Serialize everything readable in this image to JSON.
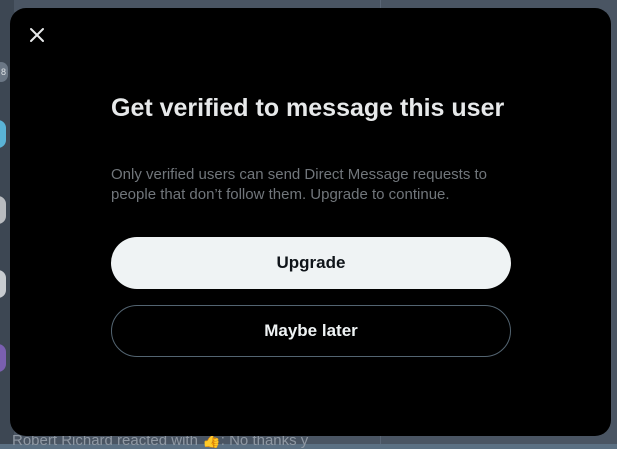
{
  "background": {
    "badge_text": "8",
    "footer_text": "Robert Richard reacted with 👍: No thanks y"
  },
  "modal": {
    "close_icon": "close-icon",
    "title": "Get verified to message this user",
    "description": "Only verified users can send Direct Message requests to people that don’t follow them. Upgrade to continue.",
    "primary_button": "Upgrade",
    "secondary_button": "Maybe later"
  },
  "colors": {
    "modal_bg": "#000000",
    "title_text": "#e7e9ea",
    "secondary_text": "#71767b",
    "primary_button_bg": "#eff3f4",
    "primary_button_text": "#0f1419",
    "secondary_button_border": "#536471",
    "backdrop": "#4a5563"
  }
}
